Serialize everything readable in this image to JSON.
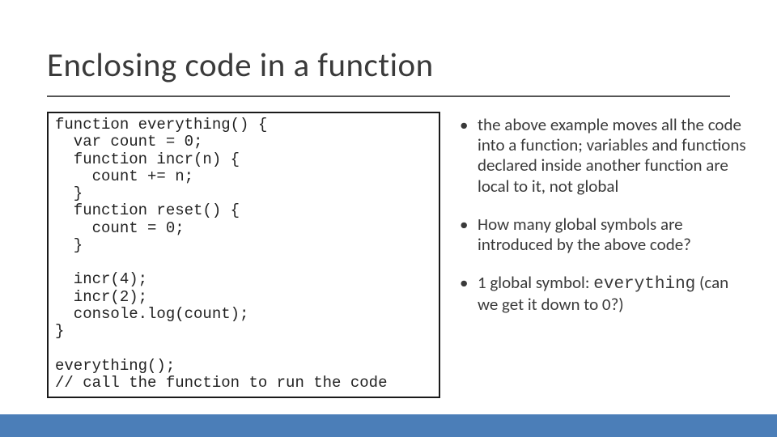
{
  "title": "Enclosing code in a function",
  "code": "function everything() {\n  var count = 0;\n  function incr(n) {\n    count += n;\n  }\n  function reset() {\n    count = 0;\n  }\n\n  incr(4);\n  incr(2);\n  console.log(count);\n}\n\neverything();\n// call the function to run the code",
  "bullets": [
    {
      "text": "the above example moves all the code into a function; variables and functions declared inside another function are local to it, not global"
    },
    {
      "text": "How many global symbols are introduced by the above code?"
    },
    {
      "pre": "1 global symbol: ",
      "mono": "everything",
      "post": " (can we get it down to 0?)"
    }
  ]
}
